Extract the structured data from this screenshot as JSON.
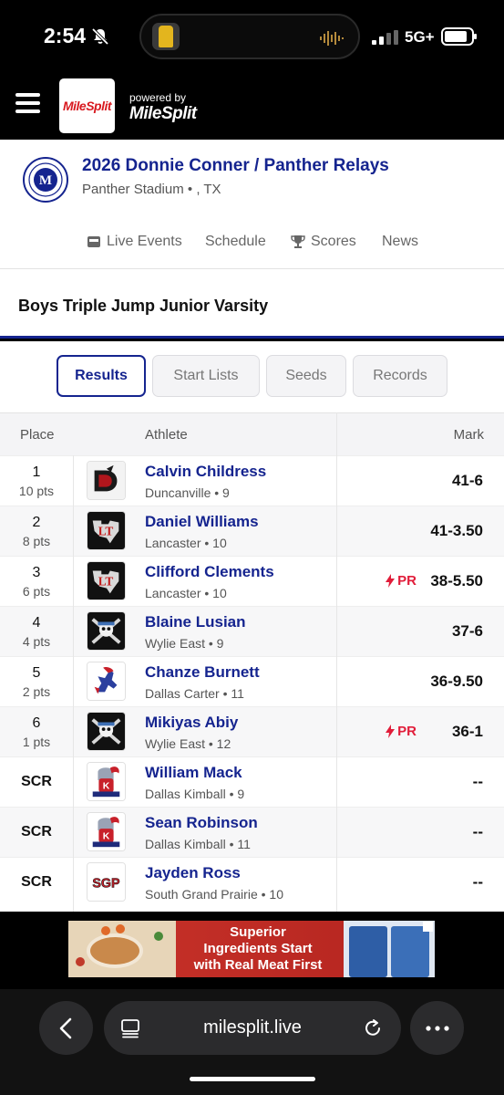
{
  "status_bar": {
    "time": "2:54",
    "network": "5G+"
  },
  "header": {
    "logo": "MileSplit",
    "powered_by": "powered by",
    "powered_logo": "MileSplit"
  },
  "meet": {
    "title": "2026 Donnie Conner / Panther Relays",
    "location": "Panther Stadium • , TX",
    "tabs": [
      {
        "label": "Live Events",
        "icon": "live-icon"
      },
      {
        "label": "Schedule"
      },
      {
        "label": "Scores",
        "icon": "trophy-icon"
      },
      {
        "label": "News"
      }
    ]
  },
  "event": {
    "title": "Boys Triple Jump Junior Varsity"
  },
  "segments": [
    "Results",
    "Start Lists",
    "Seeds",
    "Records"
  ],
  "table": {
    "headers": {
      "place": "Place",
      "athlete": "Athlete",
      "mark": "Mark"
    },
    "rows": [
      {
        "place": "1",
        "points": "10 pts",
        "name": "Calvin Childress",
        "meta": "Duncanville • 9",
        "mark": "41-6",
        "pr": "",
        "logo": "duncanville-logo"
      },
      {
        "place": "2",
        "points": "8 pts",
        "name": "Daniel Williams",
        "meta": "Lancaster • 10",
        "mark": "41-3.50",
        "pr": "",
        "logo": "lancaster-logo"
      },
      {
        "place": "3",
        "points": "6 pts",
        "name": "Clifford Clements",
        "meta": "Lancaster • 10",
        "mark": "38-5.50",
        "pr": "PR",
        "logo": "lancaster-logo"
      },
      {
        "place": "4",
        "points": "4 pts",
        "name": "Blaine Lusian",
        "meta": "Wylie East • 9",
        "mark": "37-6",
        "pr": "",
        "logo": "wylie-east-logo"
      },
      {
        "place": "5",
        "points": "2 pts",
        "name": "Chanze Burnett",
        "meta": "Dallas Carter • 11",
        "mark": "36-9.50",
        "pr": "",
        "logo": "dallas-carter-logo"
      },
      {
        "place": "6",
        "points": "1 pts",
        "name": "Mikiyas Abiy",
        "meta": "Wylie East • 12",
        "mark": "36-1",
        "pr": "PR",
        "logo": "wylie-east-logo"
      },
      {
        "place": "SCR",
        "points": "",
        "name": "William Mack",
        "meta": "Dallas Kimball • 9",
        "mark": "--",
        "pr": "",
        "logo": "dallas-kimball-logo"
      },
      {
        "place": "SCR",
        "points": "",
        "name": "Sean Robinson",
        "meta": "Dallas Kimball • 11",
        "mark": "--",
        "pr": "",
        "logo": "dallas-kimball-logo"
      },
      {
        "place": "SCR",
        "points": "",
        "name": "Jayden Ross",
        "meta": "South Grand Prairie • 10",
        "mark": "--",
        "pr": "",
        "logo": "south-grand-prairie-logo"
      }
    ]
  },
  "ad": {
    "line1": "Superior",
    "line2": "Ingredients Start",
    "line3": "with Real Meat First"
  },
  "browser": {
    "url": "milesplit.live"
  },
  "colors": {
    "brand_blue": "#15248f",
    "pr_red": "#e11d3a",
    "logo_red": "#d8191f"
  }
}
